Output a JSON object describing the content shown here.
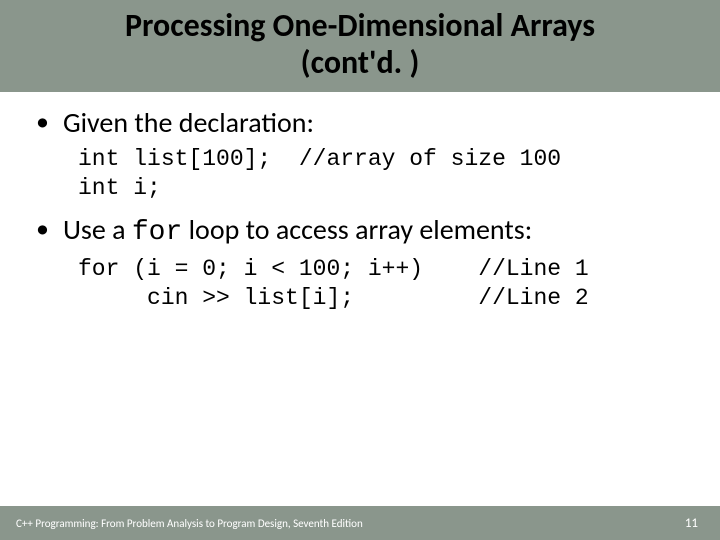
{
  "title_line1": "Processing One-Dimensional Arrays",
  "title_line2": "(cont'd. )",
  "bullets": [
    {
      "text": "Given the declaration:"
    },
    {
      "prefix": "Use a ",
      "mono": "for",
      "suffix": " loop to access array elements:"
    }
  ],
  "code1": "int list[100];  //array of size 100\nint i;",
  "code2": "for (i = 0; i < 100; i++)    //Line 1\n     cin >> list[i];         //Line 2",
  "footer": "C++ Programming: From Problem Analysis to Program Design, Seventh Edition",
  "page": "11"
}
